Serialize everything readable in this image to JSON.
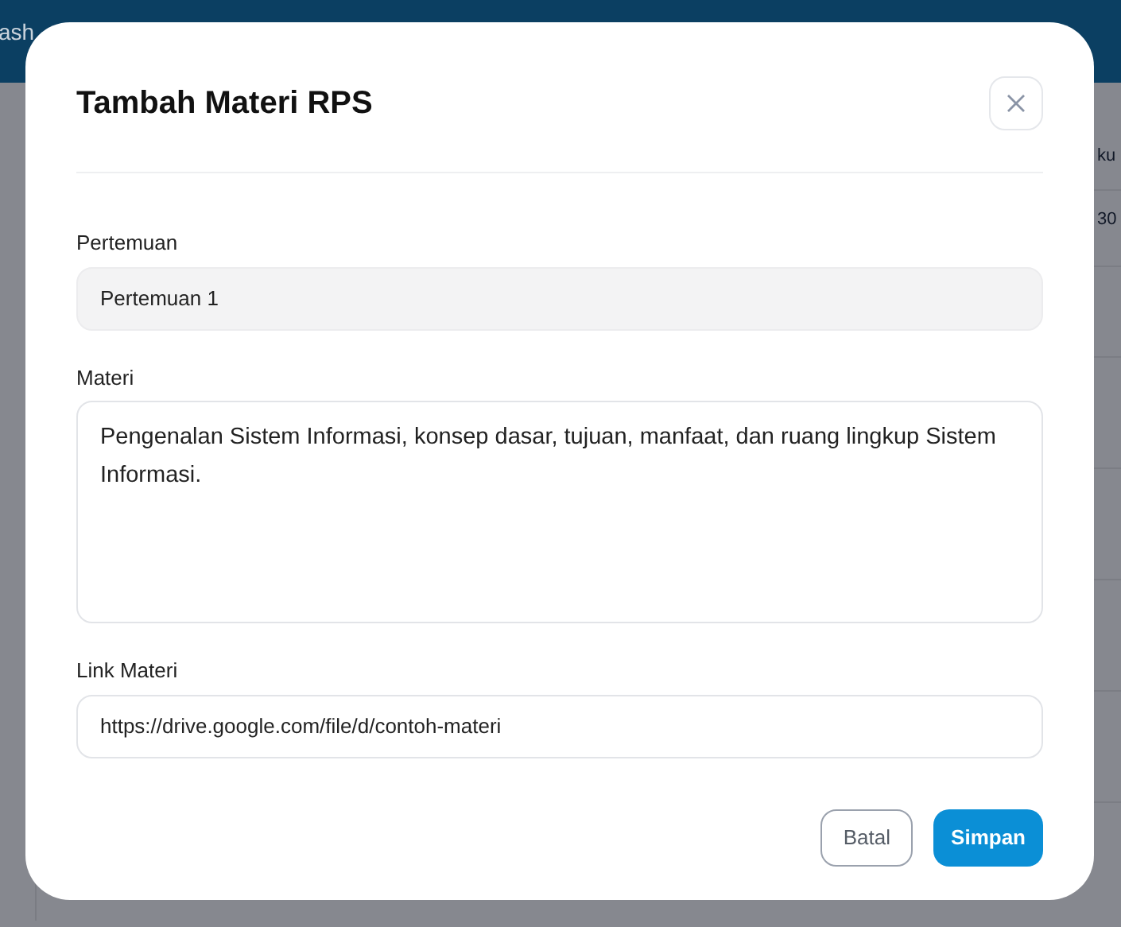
{
  "background": {
    "header_text": "ash",
    "column_text": "ku",
    "cell_text": "30"
  },
  "dialog": {
    "title": "Tambah Materi RPS",
    "fields": [
      {
        "kind": "input",
        "label": "Pertemuan",
        "value": "Pertemuan 1",
        "disabled": true
      },
      {
        "kind": "textarea",
        "label": "Materi",
        "value": "Pengenalan Sistem Informasi, konsep dasar, tujuan, manfaat, dan ruang lingkup Sistem Informasi.",
        "disabled": false
      },
      {
        "kind": "input",
        "label": "Link Materi",
        "value": "https://drive.google.com/file/d/contoh-materi",
        "disabled": false
      }
    ],
    "buttons": [
      {
        "label": "Batal",
        "kind": "secondary"
      },
      {
        "label": "Simpan",
        "kind": "primary"
      }
    ]
  }
}
